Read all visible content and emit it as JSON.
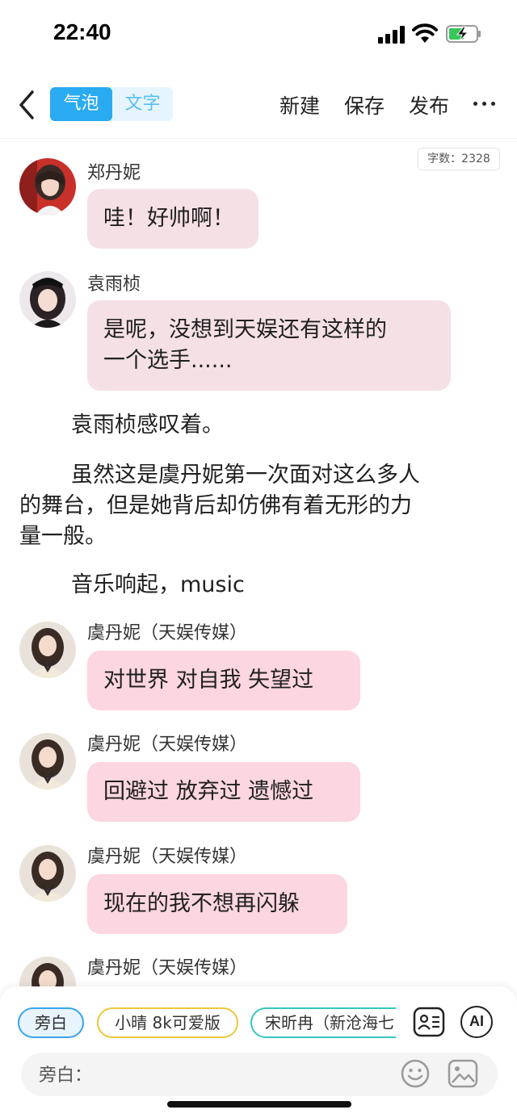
{
  "status_bar": {
    "time": "22:40"
  },
  "header": {
    "mode_bubble": "气泡",
    "mode_text": "文字",
    "new_label": "新建",
    "save_label": "保存",
    "publish_label": "发布"
  },
  "word_count": "字数：2328",
  "messages": [
    {
      "name": "郑丹妮",
      "text": "哇！好帅啊！"
    },
    {
      "name": "袁雨桢",
      "text_line1": "是呢，没想到天娱还有这样的",
      "text_line2": "一个选手......"
    },
    {
      "name": "虞丹妮（天娱传媒）",
      "text": "对世界 对自我 失望过"
    },
    {
      "name": "虞丹妮（天娱传媒）",
      "text": "回避过 放弃过 遗憾过"
    },
    {
      "name": "虞丹妮（天娱传媒）",
      "text": "现在的我不想再闪躲"
    },
    {
      "name": "虞丹妮（天娱传媒）"
    }
  ],
  "narration": {
    "p1": "袁雨桢感叹着。",
    "p2_line1": "虽然这是虞丹妮第一次面对这么多人",
    "p2_line2": "的舞台，但是她背后却仿佛有着无形的力",
    "p2_line3": "量一般。",
    "p3": "音乐响起，music"
  },
  "composer": {
    "chips": [
      "旁白",
      "小晴 8k可爱版",
      "宋昕冉（新沧海七"
    ],
    "ai_label": "AI",
    "input_label": "旁白："
  },
  "colors": {
    "accent": "#2aaaf0",
    "bubble_pale": "#f5e0e5",
    "bubble_pink": "#fcd6e0"
  }
}
